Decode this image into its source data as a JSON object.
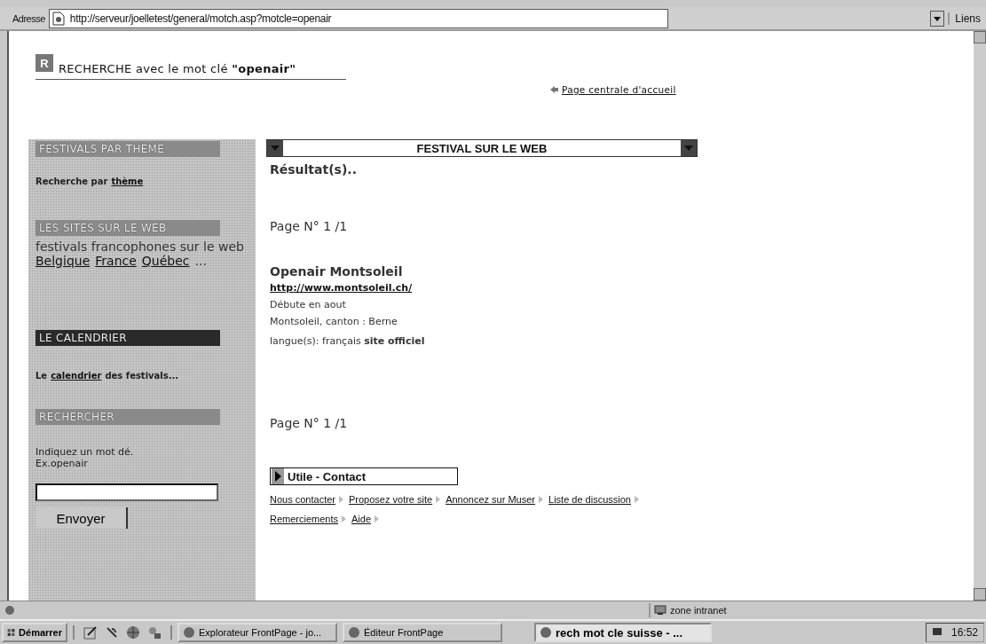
{
  "address_bar": {
    "label": "Adresse",
    "url": "http://serveur/joelletest/general/motch.asp?motcle=openair",
    "links_label": "Liens"
  },
  "page": {
    "badge": "R",
    "title": "RECHERCHE avec le mot clé **\"openair\"**",
    "home_link": "Page centrale d'accueil",
    "sidebar": [
      {
        "header": "FESTIVALS PAR THEME",
        "color": "#8a8a8a",
        "lines": [
          [
            {
              "text": "Recherche par",
              "link": false
            },
            {
              "text": "thème",
              "link": true
            }
          ]
        ]
      },
      {
        "header": "LES SITES SUR LE WEB",
        "color": "#8a8a8a",
        "lines": [
          [
            {
              "text": "festivals francophones sur le web",
              "link": false
            }
          ],
          [
            {
              "text": "Belgique",
              "link": true
            },
            {
              "text": "France",
              "link": true
            },
            {
              "text": "Québec",
              "link": true
            },
            {
              "text": "...",
              "link": false
            }
          ]
        ]
      },
      {
        "header": "LE CALENDRIER",
        "color": "#2a2a2a",
        "lines": [
          [
            {
              "text": "Le",
              "link": false
            },
            {
              "text": "calendrier",
              "link": true
            },
            {
              "text": "des festivals...",
              "link": false
            }
          ]
        ]
      },
      {
        "header": "RECHERCHER",
        "color": "#8a8a8a",
        "lines": [
          [
            {
              "text": "Indiquez un mot dé.",
              "link": false
            }
          ],
          [
            {
              "text": "Ex.openair",
              "link": false
            }
          ]
        ]
      }
    ],
    "search_button": "Envoyer",
    "banner": "FESTIVAL SUR LE WEB",
    "results_heading": "Résultat(s)..",
    "pagination_top": "Page N° 1 /1",
    "result": {
      "name": "Openair Montsoleil",
      "url": "http://www.montsoleil.ch/",
      "date": "Débute en aout",
      "location": "Montsoleil, canton : Berne",
      "languages": "langue(s): français **site officiel**"
    },
    "pagination_bottom": "Page N° 1 /1",
    "contact_banner": "Utile - Contact",
    "footer_links": [
      "Nous contacter",
      "Proposez votre site",
      "Annoncez sur Muser",
      "Liste de discussion",
      "Remerciements",
      "Aide"
    ]
  },
  "status_bar": {
    "zone": "zone intranet"
  },
  "taskbar": {
    "start": "Démarrer",
    "tasks": [
      {
        "label": "Explorateur FrontPage - jo...",
        "selected": false
      },
      {
        "label": "Éditeur FrontPage",
        "selected": false
      },
      {
        "label": "rech mot cle suisse - ...",
        "selected": true
      }
    ],
    "clock": "16:52"
  }
}
